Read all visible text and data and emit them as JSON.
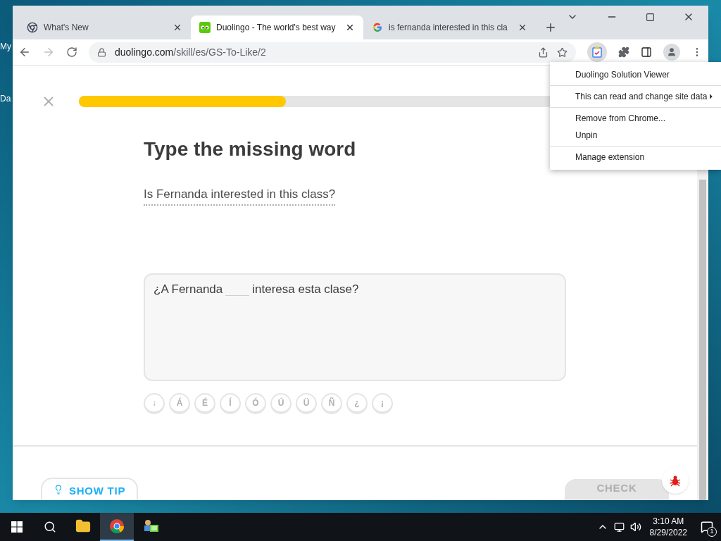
{
  "desktop_icons": [
    {
      "label": "My"
    },
    {
      "label": "Da"
    }
  ],
  "browser": {
    "tabs": [
      {
        "title": "What's New",
        "kind": "chrome",
        "selected": false
      },
      {
        "title": "Duolingo - The world's best way",
        "kind": "duo",
        "selected": true
      },
      {
        "title": "is fernanda interested in this cla",
        "kind": "google",
        "selected": false
      }
    ],
    "address": {
      "domain": "duolingo.com",
      "path": "/skill/es/GS-To-Like/2"
    }
  },
  "extension_menu": {
    "sections": [
      {
        "items": [
          {
            "label": "Duolingo Solution Viewer",
            "submenu": false
          }
        ]
      },
      {
        "items": [
          {
            "label": "This can read and change site data",
            "submenu": true
          }
        ]
      },
      {
        "items": [
          {
            "label": "Remove from Chrome...",
            "submenu": false
          },
          {
            "label": "Unpin",
            "submenu": false
          }
        ]
      },
      {
        "items": [
          {
            "label": "Manage extension",
            "submenu": false
          }
        ]
      }
    ]
  },
  "lesson": {
    "progress": {
      "level": 0.36
    },
    "title": "Type the missing word",
    "prompt": "Is Fernanda interested in this class?",
    "sentence_before": "¿A Fernanda",
    "sentence_after": "interesa esta clase?",
    "keys": [
      "↓",
      "Á",
      "É",
      "Í",
      "Ó",
      "Ú",
      "Ü",
      "Ñ",
      "¿",
      "¡"
    ],
    "tip_button": "SHOW TIP",
    "check_button": "CHECK"
  },
  "taskbar": {
    "apps": [
      {
        "kind": "explorer",
        "active": false
      },
      {
        "kind": "chrome",
        "active": true
      },
      {
        "kind": "network-app",
        "active": false
      }
    ],
    "time": "3:10 AM",
    "date": "8/29/2022",
    "notifications": "1"
  }
}
